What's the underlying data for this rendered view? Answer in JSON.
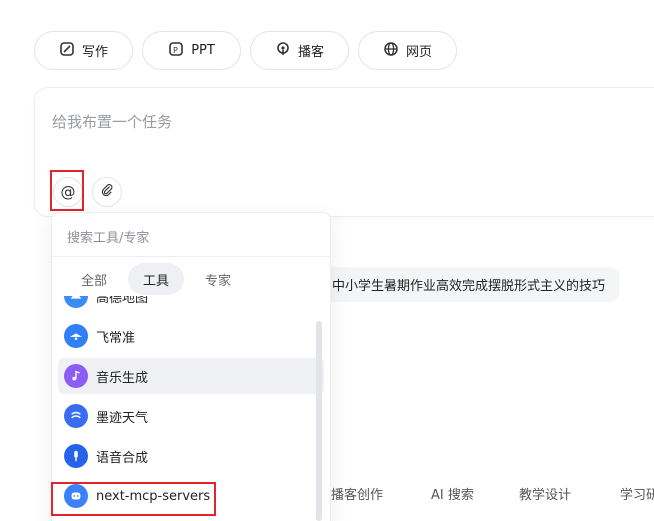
{
  "modes": [
    {
      "label": "写作",
      "icon": "write-icon"
    },
    {
      "label": "PPT",
      "icon": "ppt-icon"
    },
    {
      "label": "播客",
      "icon": "podcast-icon"
    },
    {
      "label": "网页",
      "icon": "globe-icon"
    }
  ],
  "task": {
    "placeholder": "给我布置一个任务",
    "at_symbol": "@",
    "clip_icon": "paperclip-icon"
  },
  "suggestion": "中小学生暑期作业高效完成摆脱形式主义的技巧",
  "categories": [
    "播客创作",
    "AI 搜索",
    "教学设计",
    "学习研"
  ],
  "dropdown": {
    "search_placeholder": "搜索工具/专家",
    "tabs": [
      {
        "label": "全部",
        "active": false
      },
      {
        "label": "工具",
        "active": true
      },
      {
        "label": "专家",
        "active": false
      }
    ],
    "items": [
      {
        "label": "高德地图",
        "icon": "map-icon",
        "color": "#3b8cf5"
      },
      {
        "label": "飞常准",
        "icon": "plane-icon",
        "color": "#2f7ff5"
      },
      {
        "label": "音乐生成",
        "icon": "music-icon",
        "color": "#8b5cf6"
      },
      {
        "label": "墨迹天气",
        "icon": "weather-icon",
        "color": "#3a6df0"
      },
      {
        "label": "语音合成",
        "icon": "microphone-icon",
        "color": "#2563eb"
      },
      {
        "label": "next-mcp-servers",
        "icon": "server-icon",
        "color": "#3b82f6"
      }
    ]
  },
  "colors": {
    "highlight_frame": "#e0262b",
    "border": "#e3e4e8"
  }
}
